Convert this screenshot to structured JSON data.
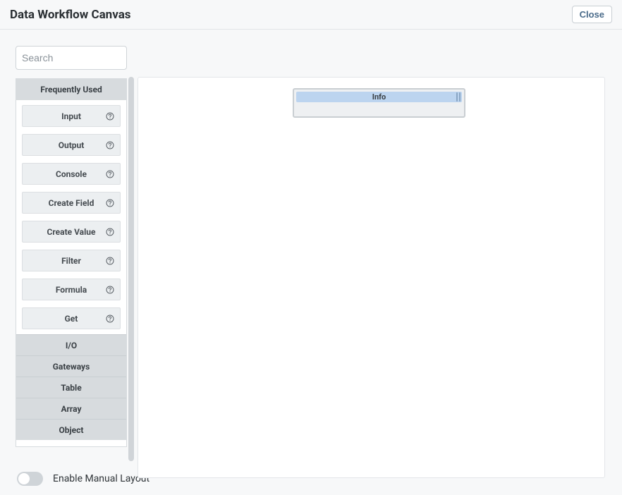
{
  "header": {
    "title": "Data Workflow Canvas",
    "close_label": "Close"
  },
  "search": {
    "placeholder": "Search",
    "value": ""
  },
  "categories": [
    {
      "label": "Frequently Used",
      "expanded": true,
      "items": [
        {
          "label": "Input"
        },
        {
          "label": "Output"
        },
        {
          "label": "Console"
        },
        {
          "label": "Create Field"
        },
        {
          "label": "Create Value"
        },
        {
          "label": "Filter"
        },
        {
          "label": "Formula"
        },
        {
          "label": "Get"
        }
      ]
    },
    {
      "label": "I/O",
      "expanded": false
    },
    {
      "label": "Gateways",
      "expanded": false
    },
    {
      "label": "Table",
      "expanded": false
    },
    {
      "label": "Array",
      "expanded": false
    },
    {
      "label": "Object",
      "expanded": false
    }
  ],
  "canvas": {
    "node": {
      "title": "Info"
    }
  },
  "footer": {
    "toggle_label": "Enable Manual Layout",
    "toggle_on": false
  }
}
